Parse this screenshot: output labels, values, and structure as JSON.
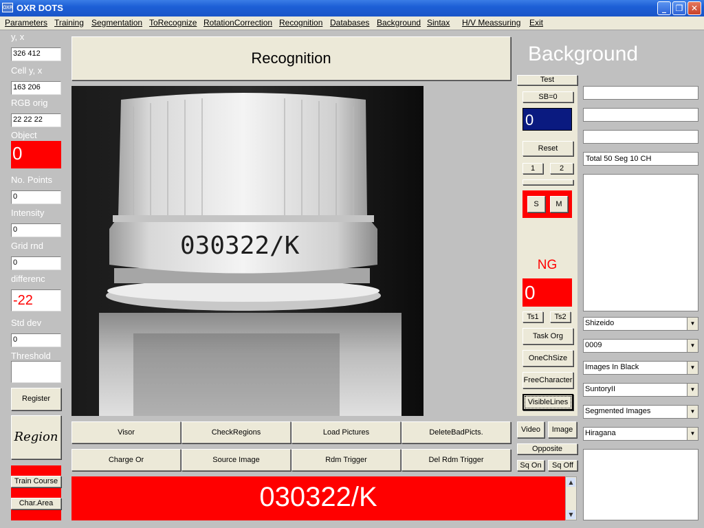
{
  "window": {
    "title": "OXR DOTS",
    "icon_text": "OXR",
    "minimize": "_",
    "maximize": "❐",
    "close": "✕"
  },
  "menu": [
    "Parameters",
    "Training",
    "Segmentation",
    "ToRecognize",
    "RotationCorrection",
    "Recognition",
    "Databases",
    "Background",
    "Sintax",
    "H/V Meassuring",
    "Exit"
  ],
  "left": {
    "yx_label": "y, x",
    "yx_value": "326 412",
    "cell_label": "Cell y, x",
    "cell_value": "163 206",
    "rgb_label": "RGB orig",
    "rgb_value": "22 22 22",
    "object_label": "Object",
    "object_value": "0",
    "points_label": "No. Points",
    "points_value": "0",
    "intensity_label": "Intensity",
    "intensity_value": "0",
    "grid_label": "Grid rnd",
    "grid_value": "0",
    "diff_label": "differenc",
    "diff_value": "-22",
    "std_label": "Std dev",
    "std_value": "0",
    "threshold_label": "Threshold",
    "threshold_value": "",
    "register": "Register",
    "region": "Region",
    "train_course": "Train Course",
    "char_area": "Char.Area"
  },
  "header": {
    "recognition": "Recognition",
    "background": "Background"
  },
  "image": {
    "printed_text": "030322/K"
  },
  "bottom_buttons": {
    "row1": [
      "Visor",
      "CheckRegions",
      "Load Pictures",
      "DeleteBadPicts."
    ],
    "row2": [
      "Charge Or",
      "Source Image",
      "Rdm Trigger",
      "Del Rdm Trigger"
    ]
  },
  "result_text": "030322/K",
  "mid": {
    "test": "Test",
    "sb": "SB=0",
    "sb_value": "0",
    "reset": "Reset",
    "one": "1",
    "two": "2",
    "s": "S",
    "m": "M",
    "ng": "NG",
    "ng_value": "0",
    "ts1": "Ts1",
    "ts2": "Ts2",
    "task_org": "Task Org",
    "one_ch_size": "OneChSize",
    "free_character": "FreeCharacter",
    "visible_lines": "VisibleLines",
    "video": "Video",
    "image": "Image",
    "opposite": "Opposite",
    "sq_on": "Sq On",
    "sq_off": "Sq Off"
  },
  "right": {
    "field1": "",
    "field2": "",
    "field3": "",
    "total_text": "Total 50  Seg 10  CH",
    "combos": [
      "Shizeido",
      "0009",
      "Images In Black",
      "SuntoryII",
      "Segmented Images",
      "Hiragana"
    ]
  },
  "colors": {
    "red": "#ff0000",
    "navy": "#0a1a80",
    "title_blue": "#1d5fd6"
  }
}
